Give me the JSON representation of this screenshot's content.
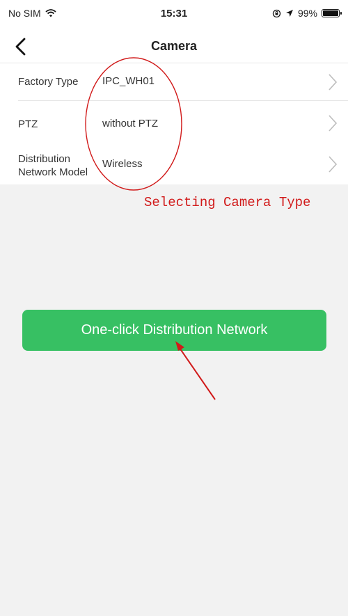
{
  "status_bar": {
    "carrier": "No SIM",
    "time": "15:31",
    "battery_percent": "99%",
    "battery_level": 0.99
  },
  "nav": {
    "title": "Camera"
  },
  "settings": [
    {
      "label": "Factory Type",
      "value": "IPC_WH01"
    },
    {
      "label": "PTZ",
      "value": "without PTZ"
    },
    {
      "label_line1": "Distribution",
      "label_line2": "Network Model",
      "value": "Wireless"
    }
  ],
  "annotation": {
    "text": "Selecting Camera Type",
    "color": "#d11a1a"
  },
  "primary_button": {
    "label": "One-click Distribution Network",
    "color": "#37c063"
  }
}
